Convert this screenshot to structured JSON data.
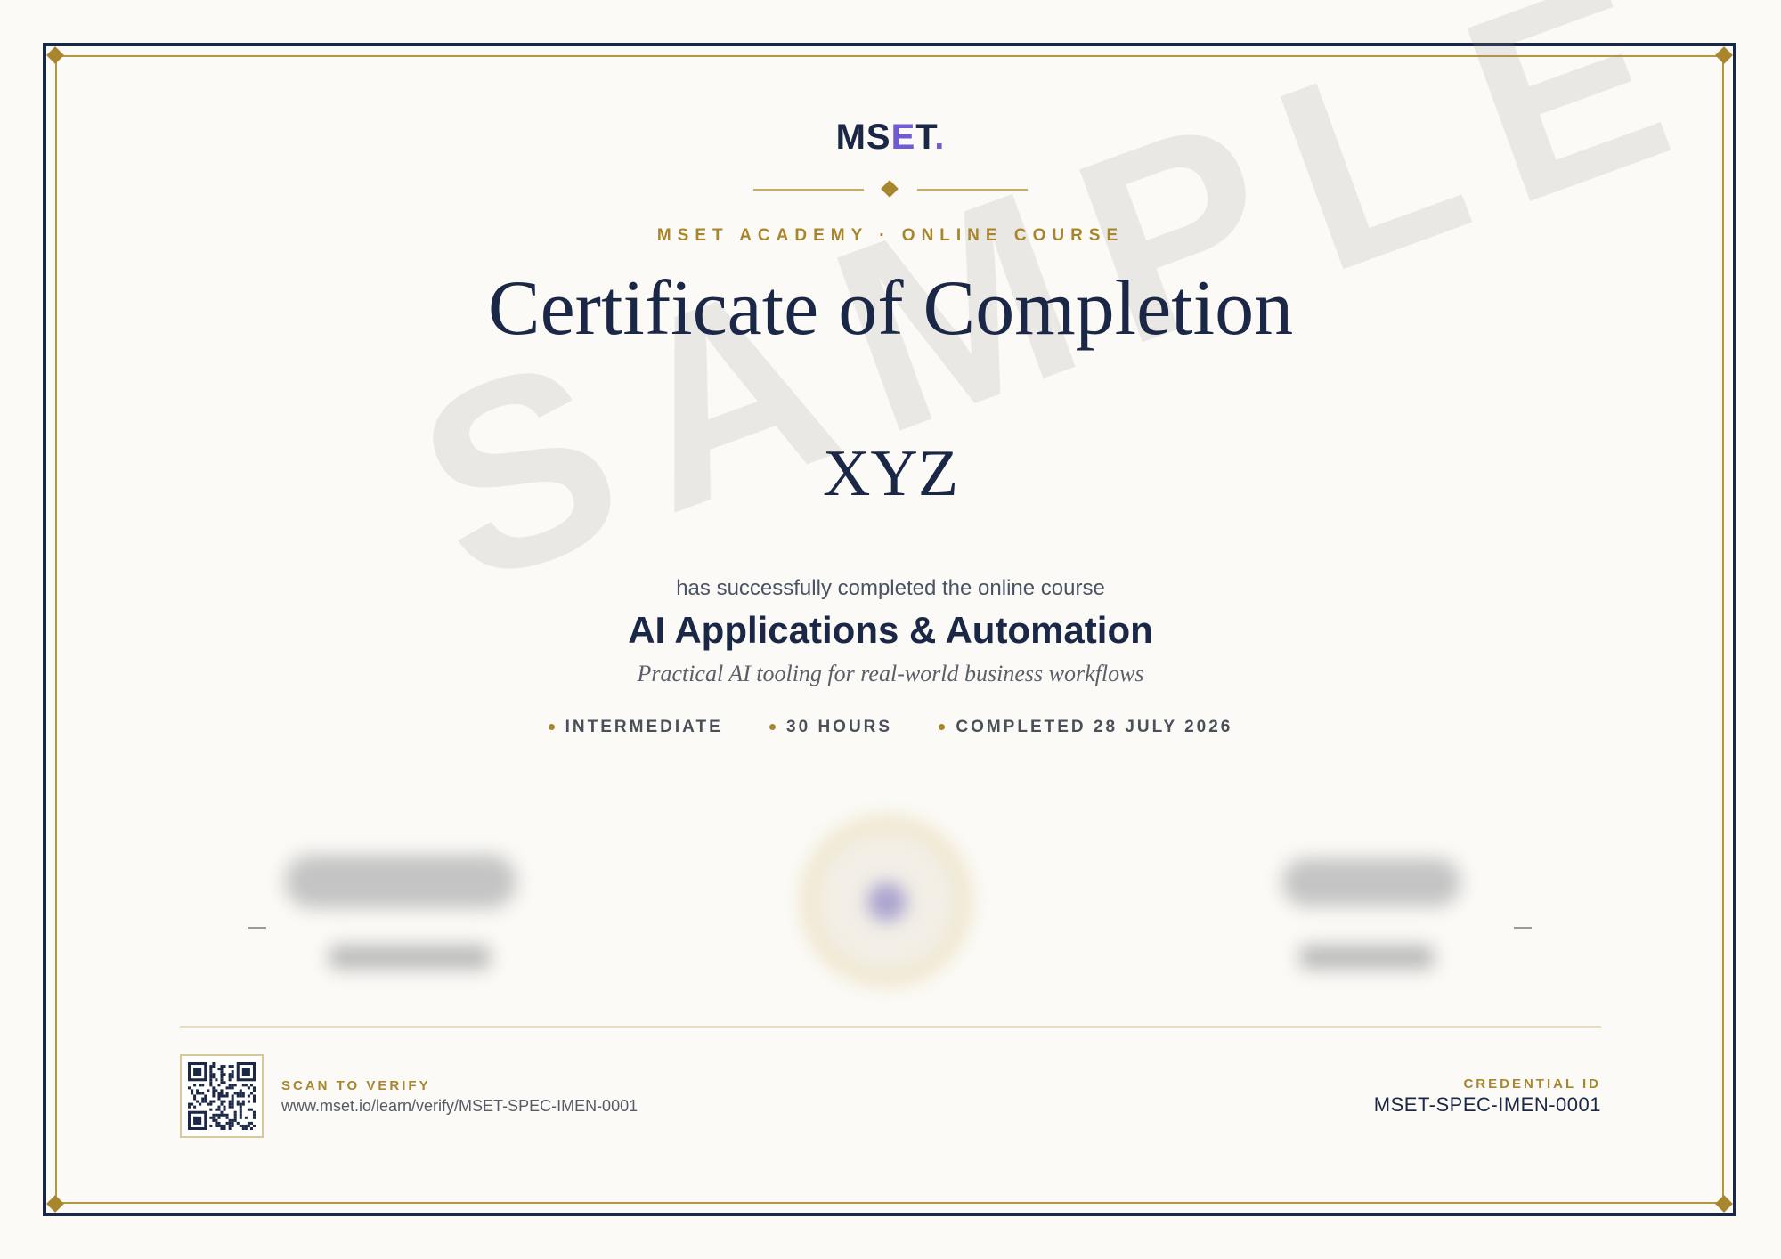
{
  "logo": {
    "part1": "MS",
    "part2": "E",
    "part3": "T",
    "dot": "."
  },
  "header": {
    "eyebrow": "MSET ACADEMY · ONLINE COURSE",
    "title": "Certificate of Completion"
  },
  "watermark": "SAMPLE",
  "recipient": {
    "name": "XYZ"
  },
  "course": {
    "intro": "has successfully completed the online course",
    "name": "AI Applications & Automation",
    "tagline": "Practical AI tooling for real-world business workflows"
  },
  "meta": {
    "level": "INTERMEDIATE",
    "duration": "30 HOURS",
    "completed": "COMPLETED 28 JULY 2026"
  },
  "verify": {
    "label": "SCAN TO VERIFY",
    "url": "www.mset.io/learn/verify/MSET-SPEC-IMEN-0001"
  },
  "credential": {
    "label": "CREDENTIAL ID",
    "id": "MSET-SPEC-IMEN-0001"
  },
  "colors": {
    "navy": "#1b2746",
    "gold": "#a8862e",
    "accent": "#6f5bd6",
    "paper": "#fbfaf6"
  }
}
